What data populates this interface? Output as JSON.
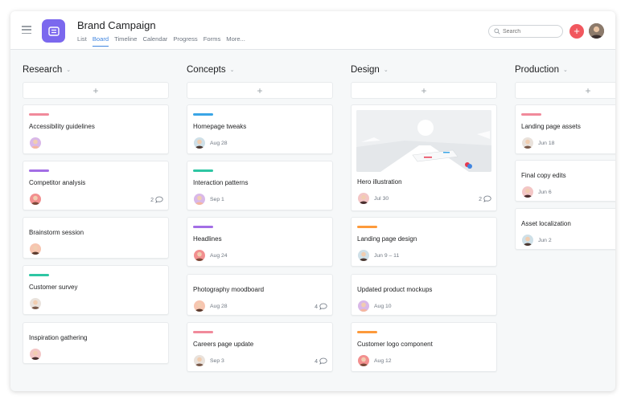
{
  "project": {
    "title": "Brand Campaign",
    "tabs": [
      "List",
      "Board",
      "Timeline",
      "Calendar",
      "Progress",
      "Forms",
      "More..."
    ],
    "active_tab": "Board"
  },
  "search": {
    "placeholder": "Search"
  },
  "header": {
    "add_label": "+"
  },
  "colors": {
    "pink": "#f18a9b",
    "purple": "#a36ee5",
    "teal": "#2ec6a3",
    "blue": "#3aa5e6",
    "orange": "#fd9a3b",
    "accent": "#4186e0",
    "add_button": "#f1575e"
  },
  "columns": [
    {
      "title": "Research",
      "add": "+",
      "cards": [
        {
          "tag": "pink",
          "title": "Accessibility guidelines",
          "date": "",
          "comments": ""
        },
        {
          "tag": "purple",
          "title": "Competitor analysis",
          "date": "",
          "comments": "2"
        },
        {
          "tag": "",
          "title": "Brainstorm session",
          "date": "",
          "comments": ""
        },
        {
          "tag": "teal",
          "title": "Customer survey",
          "date": "",
          "comments": ""
        },
        {
          "tag": "",
          "title": "Inspiration gathering",
          "date": "",
          "comments": ""
        }
      ]
    },
    {
      "title": "Concepts",
      "add": "+",
      "cards": [
        {
          "tag": "blue",
          "title": "Homepage tweaks",
          "date": "Aug 28",
          "comments": ""
        },
        {
          "tag": "teal",
          "title": "Interaction patterns",
          "date": "Sep 1",
          "comments": ""
        },
        {
          "tag": "purple",
          "title": "Headlines",
          "date": "Aug 24",
          "comments": ""
        },
        {
          "tag": "",
          "title": "Photography moodboard",
          "date": "Aug 28",
          "comments": "4"
        },
        {
          "tag": "pink",
          "title": "Careers page update",
          "date": "Sep 3",
          "comments": "4"
        }
      ]
    },
    {
      "title": "Design",
      "add": "+",
      "cards": [
        {
          "tag": "",
          "title": "Hero illustration",
          "date": "Jul 30",
          "comments": "2",
          "image": "hero-illustration"
        },
        {
          "tag": "orange",
          "title": "Landing page design",
          "date": "Jun 9 – 11",
          "comments": ""
        },
        {
          "tag": "",
          "title": "Updated product mockups",
          "date": "Aug 10",
          "comments": ""
        },
        {
          "tag": "orange",
          "title": "Customer logo component",
          "date": "Aug 12",
          "comments": ""
        }
      ]
    },
    {
      "title": "Production",
      "add": "+",
      "cards": [
        {
          "tag": "pink",
          "title": "Landing page assets",
          "date": "Jun 18",
          "comments": ""
        },
        {
          "tag": "",
          "title": "Final copy edits",
          "date": "Jun 6",
          "comments": ""
        },
        {
          "tag": "",
          "title": "Asset localization",
          "date": "Jun 2",
          "comments": ""
        }
      ]
    }
  ]
}
